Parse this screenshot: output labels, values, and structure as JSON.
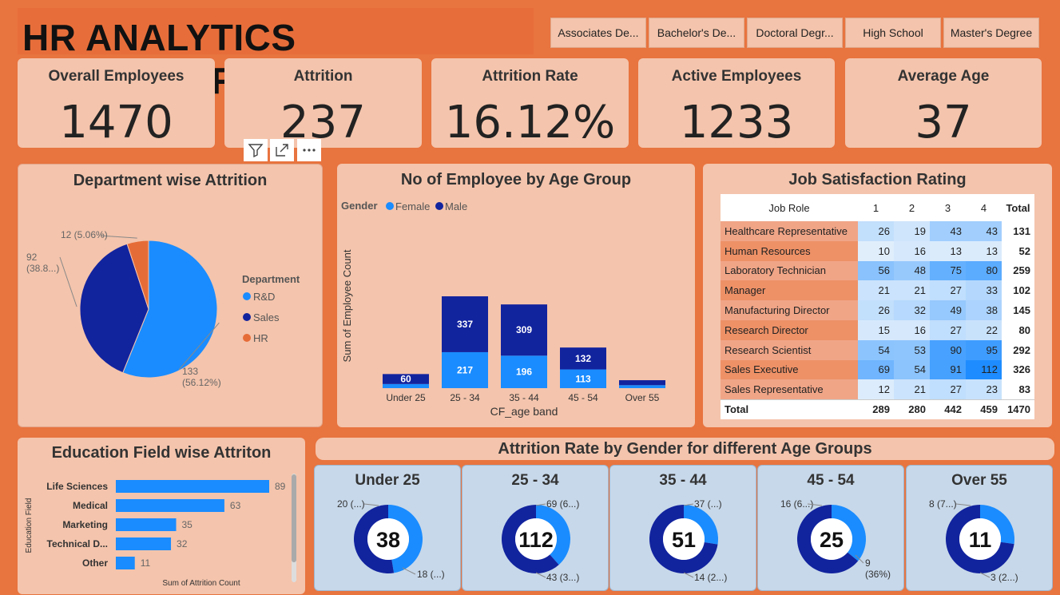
{
  "header": {
    "title": "HR ANALYTICS DASHBOARD",
    "slicers": [
      "Associates De...",
      "Bachelor's De...",
      "Doctoral Degr...",
      "High School",
      "Master's Degree"
    ]
  },
  "kpis": [
    {
      "label": "Overall Employees",
      "value": "1470"
    },
    {
      "label": "Attrition",
      "value": "237"
    },
    {
      "label": "Attrition Rate",
      "value": "16.12%"
    },
    {
      "label": "Active Employees",
      "value": "1233"
    },
    {
      "label": "Average Age",
      "value": "37"
    }
  ],
  "visual_header_icons": [
    "filter-icon",
    "focus-mode-icon",
    "more-options-icon"
  ],
  "colors": {
    "background": "#E8743F",
    "card": "#F4C4AC",
    "female": "#1A8CFF",
    "male": "#12239E",
    "hr": "#E66C37",
    "donut_card": "#C7D8EA"
  },
  "dept_chart": {
    "legend_title": "Department"
  },
  "age_chart": {
    "legend_title": "Gender",
    "ylabel": "Sum of Employee Count",
    "xlabel": "CF_age band"
  },
  "edu_chart": {
    "ylabel": "Education Field",
    "xlabel": "Sum of Attrition Count"
  },
  "donut_section_title": "Attrition Rate by Gender for different Age Groups",
  "chart_data": [
    {
      "type": "pie",
      "title": "Department wise Attrition",
      "categories": [
        "R&D",
        "Sales",
        "HR"
      ],
      "values": [
        133,
        92,
        12
      ],
      "labels": [
        "133\n(56.12%)",
        "92\n(38.8...)",
        "12 (5.06%)"
      ],
      "colors": [
        "#1A8CFF",
        "#12239E",
        "#E66C37"
      ],
      "legend": "right"
    },
    {
      "type": "bar",
      "stacked": true,
      "title": "No of Employee by Age Group",
      "categories": [
        "Under 25",
        "25 - 34",
        "35 - 44",
        "45 - 54",
        "Over 55"
      ],
      "series": [
        {
          "name": "Female",
          "values": [
            25,
            217,
            196,
            113,
            18
          ],
          "labels": [
            "",
            "217",
            "196",
            "113",
            ""
          ],
          "color": "#1A8CFF"
        },
        {
          "name": "Male",
          "values": [
            60,
            337,
            309,
            132,
            30
          ],
          "labels": [
            "60",
            "337",
            "309",
            "132",
            ""
          ],
          "color": "#12239E"
        }
      ],
      "xlabel": "CF_age band",
      "ylabel": "Sum of Employee Count",
      "legend": "top-left"
    },
    {
      "type": "table",
      "title": "Job Satisfaction Rating",
      "columns": [
        "Job Role",
        "1",
        "2",
        "3",
        "4",
        "Total"
      ],
      "rows": [
        [
          "Healthcare Representative",
          26,
          19,
          43,
          43,
          131
        ],
        [
          "Human Resources",
          10,
          16,
          13,
          13,
          52
        ],
        [
          "Laboratory Technician",
          56,
          48,
          75,
          80,
          259
        ],
        [
          "Manager",
          21,
          21,
          27,
          33,
          102
        ],
        [
          "Manufacturing Director",
          26,
          32,
          49,
          38,
          145
        ],
        [
          "Research Director",
          15,
          16,
          27,
          22,
          80
        ],
        [
          "Research Scientist",
          54,
          53,
          90,
          95,
          292
        ],
        [
          "Sales Executive",
          69,
          54,
          91,
          112,
          326
        ],
        [
          "Sales Representative",
          12,
          21,
          27,
          23,
          83
        ]
      ],
      "total_row": [
        "Total",
        289,
        280,
        442,
        459,
        1470
      ]
    },
    {
      "type": "bar",
      "orientation": "horizontal",
      "title": "Education Field wise Attriton",
      "categories": [
        "Life Sciences",
        "Medical",
        "Marketing",
        "Technical D...",
        "Other"
      ],
      "values": [
        89,
        63,
        35,
        32,
        11
      ],
      "xlabel": "Sum of Attrition Count",
      "ylabel": "Education Field",
      "color": "#1A8CFF"
    },
    {
      "type": "pie",
      "subtype": "donut",
      "title": "Attrition Rate by Gender for different Age Groups",
      "groups": [
        {
          "name": "Under 25",
          "total": "38",
          "male": 20,
          "female": 18,
          "male_label": "20 (...)",
          "female_label": "18 (...)"
        },
        {
          "name": "25 - 34",
          "total": "112",
          "male": 69,
          "female": 43,
          "male_label": "69 (6...)",
          "female_label": "43 (3...)"
        },
        {
          "name": "35 - 44",
          "total": "51",
          "male": 37,
          "female": 14,
          "male_label": "37 (...)",
          "female_label": "14 (2...)"
        },
        {
          "name": "45 - 54",
          "total": "25",
          "male": 16,
          "female": 9,
          "male_label": "16 (6...)",
          "female_label": "9\n(36%)"
        },
        {
          "name": "Over 55",
          "total": "11",
          "male": 8,
          "female": 3,
          "male_label": "8 (7...)",
          "female_label": "3 (2...)"
        }
      ]
    }
  ]
}
